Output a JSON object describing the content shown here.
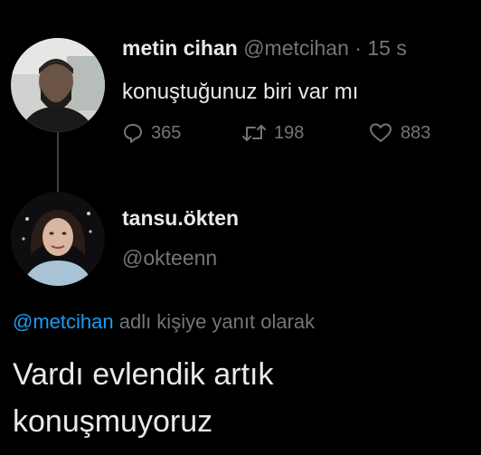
{
  "original_tweet": {
    "display_name": "metin cihan",
    "handle": "@metcihan",
    "separator": "·",
    "time": "15 s",
    "text": "konuştuğunuz biri var mı",
    "reply_count": "365",
    "retweet_count": "198",
    "like_count": "883"
  },
  "reply_tweet": {
    "display_name": "tansu.ökten",
    "handle": "@okteenn",
    "context_mention": "@metcihan",
    "context_text": " adlı kişiye yanıt olarak",
    "text": "Vardı evlendik artık konuşmuyoruz"
  },
  "colors": {
    "background": "#000000",
    "text_primary": "#e7e9ea",
    "text_secondary": "#71767b",
    "accent": "#1d9bf0"
  }
}
